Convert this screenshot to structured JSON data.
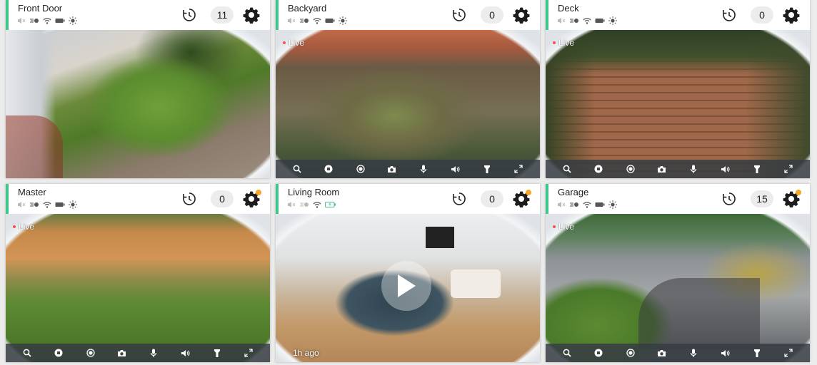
{
  "colors": {
    "accent": "#3fc68b",
    "live_dot": "#f1554b",
    "notify_dot": "#f5a623",
    "controls_bg": "#373c42"
  },
  "icons": {
    "status": [
      "speaker-muted-icon",
      "motion-icon",
      "wifi-icon",
      "battery-icon",
      "light-icon"
    ],
    "controls": [
      "search-icon",
      "stop-icon",
      "record-icon",
      "camera-icon",
      "microphone-icon",
      "volume-icon",
      "flashlight-icon",
      "fullscreen-icon"
    ],
    "header": [
      "history-icon",
      "gear-icon"
    ]
  },
  "cameras": [
    {
      "name": "Front Door",
      "count": "11",
      "live_label": "",
      "battery": "normal",
      "settings_alert": false
    },
    {
      "name": "Backyard",
      "count": "0",
      "live_label": "Live",
      "battery": "normal",
      "settings_alert": false
    },
    {
      "name": "Deck",
      "count": "0",
      "live_label": "Live",
      "battery": "normal",
      "settings_alert": false
    },
    {
      "name": "Master",
      "count": "0",
      "live_label": "Live",
      "battery": "normal",
      "settings_alert": true
    },
    {
      "name": "Living Room",
      "count": "0",
      "live_label": "",
      "battery": "charging",
      "settings_alert": true,
      "ago_label": "1h ago"
    },
    {
      "name": "Garage",
      "count": "15",
      "live_label": "Live",
      "battery": "normal",
      "settings_alert": true
    }
  ]
}
